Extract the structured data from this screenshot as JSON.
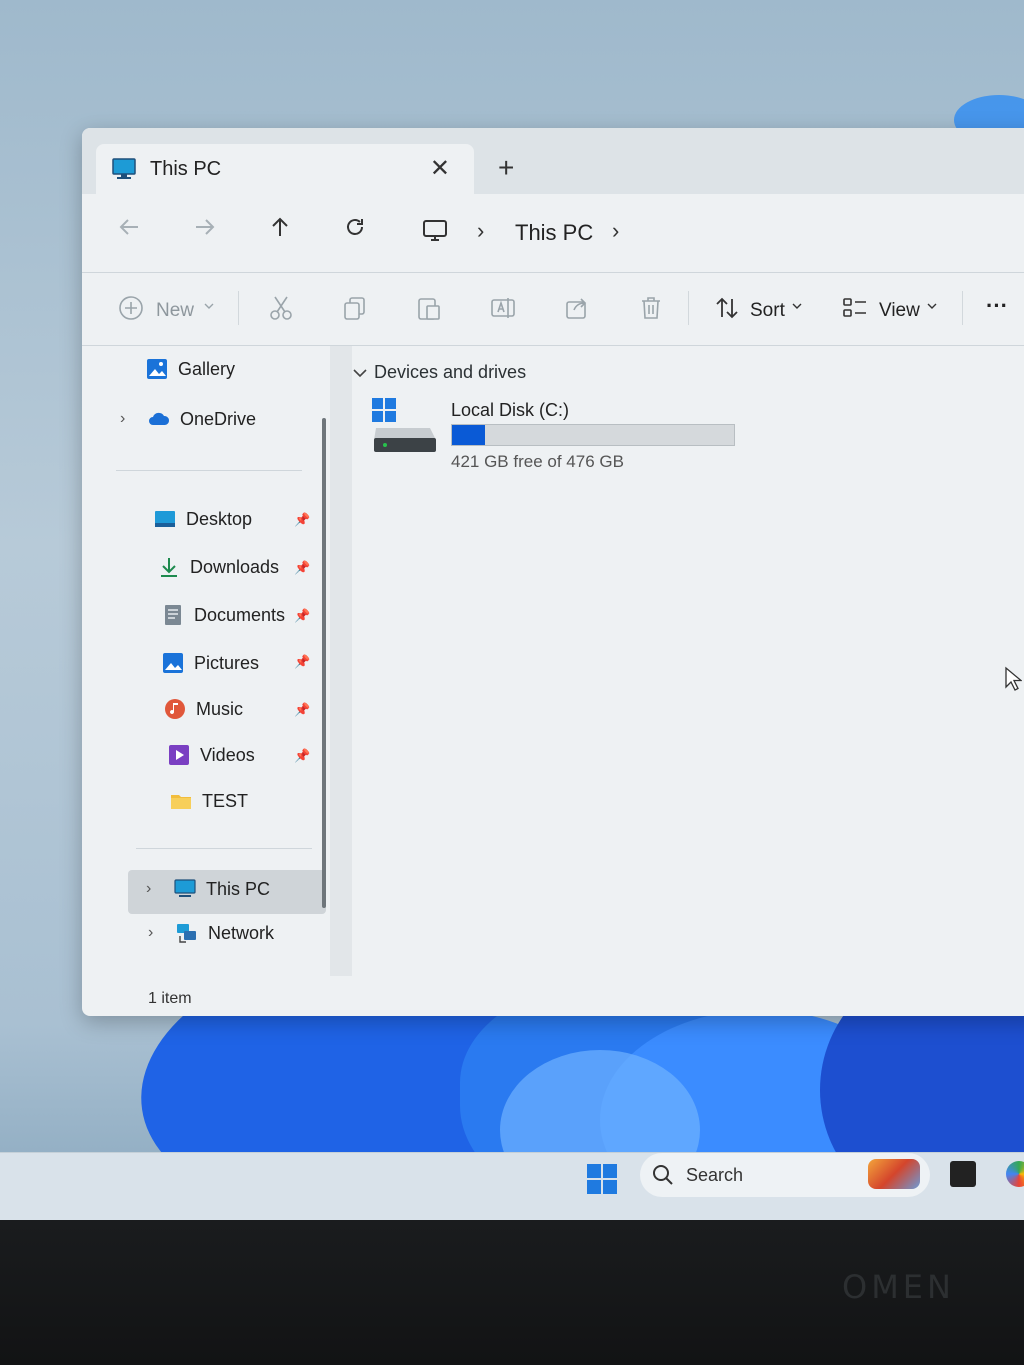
{
  "tab": {
    "title": "This PC",
    "close": "✕",
    "new_tab": "+"
  },
  "address": {
    "crumb": "This PC"
  },
  "toolbar": {
    "new_label": "New",
    "sort_label": "Sort",
    "view_label": "View",
    "more_label": "···"
  },
  "sidebar": {
    "items": [
      {
        "label": "Gallery"
      },
      {
        "label": "OneDrive"
      },
      {
        "label": "Desktop"
      },
      {
        "label": "Downloads"
      },
      {
        "label": "Documents"
      },
      {
        "label": "Pictures"
      },
      {
        "label": "Music"
      },
      {
        "label": "Videos"
      },
      {
        "label": "TEST"
      },
      {
        "label": "This PC"
      },
      {
        "label": "Network"
      }
    ]
  },
  "content": {
    "group_header": "Devices and drives",
    "drive": {
      "name": "Local Disk (C:)",
      "free_text": "421 GB free of 476 GB",
      "used_fraction": 0.116
    }
  },
  "status": {
    "item_count": "1 item"
  },
  "taskbar": {
    "search_label": "Search"
  },
  "brand": {
    "text": "OMEN"
  },
  "colors": {
    "accent": "#0a5ad6",
    "window_bg": "#eef1f3"
  }
}
